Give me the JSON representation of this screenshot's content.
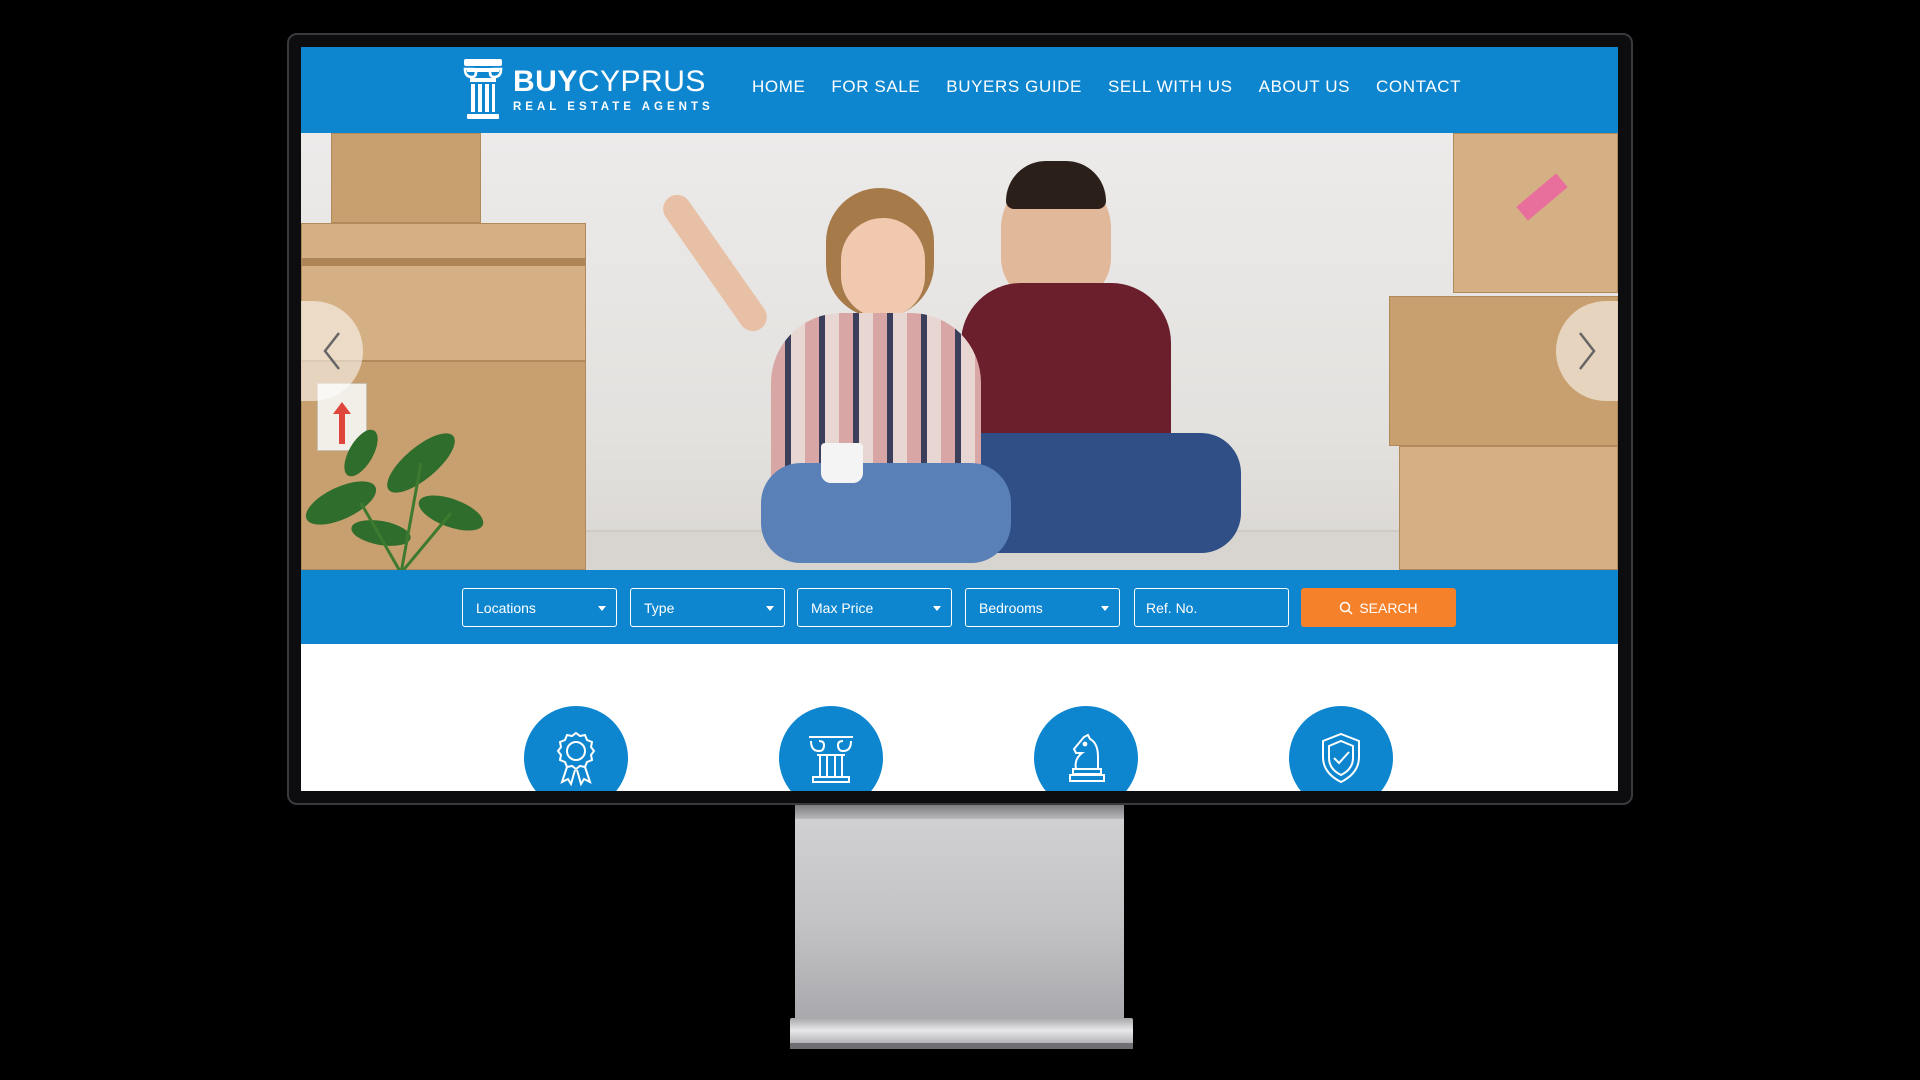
{
  "brand": {
    "name_bold": "BUY",
    "name_regular": "CYPRUS",
    "tagline": "REAL ESTATE AGENTS",
    "color_primary": "#0d86cf",
    "color_accent": "#f5822b"
  },
  "nav": {
    "items": [
      {
        "label": "HOME"
      },
      {
        "label": "FOR SALE"
      },
      {
        "label": "BUYERS GUIDE"
      },
      {
        "label": "SELL WITH US"
      },
      {
        "label": "ABOUT US"
      },
      {
        "label": "CONTACT"
      }
    ]
  },
  "hero": {
    "prev_icon": "chevron-left-icon",
    "next_icon": "chevron-right-icon"
  },
  "search": {
    "locations": "Locations",
    "type": "Type",
    "max_price": "Max Price",
    "bedrooms": "Bedrooms",
    "ref_placeholder": "Ref. No.",
    "button_label": "SEARCH"
  },
  "features": {
    "icons": [
      "award-ribbon-icon",
      "ionic-column-icon",
      "chess-knight-icon",
      "shield-check-icon"
    ]
  }
}
